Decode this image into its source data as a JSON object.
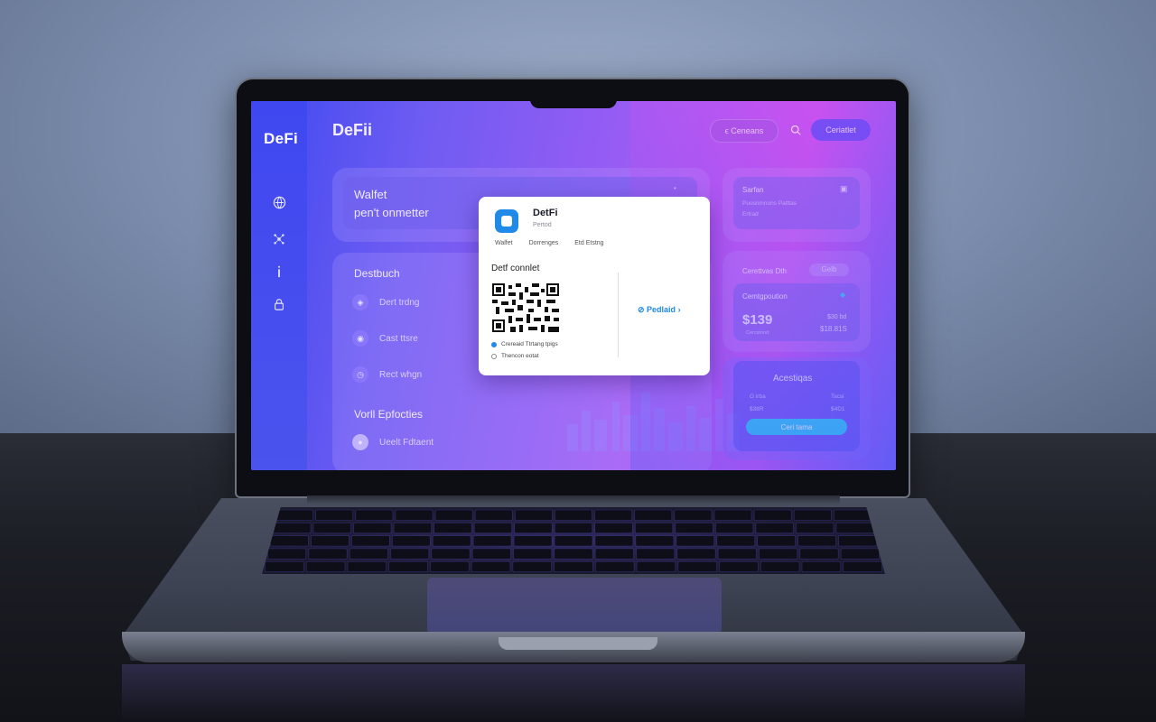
{
  "app": {
    "sidebar_logo": "DeFi",
    "brand": "DeFii",
    "header": {
      "status_pill": "ϵ Ceneans",
      "search_icon": "search-icon",
      "connect_label": "Ceriatlet"
    }
  },
  "sidebar": {
    "icons": [
      "globe-icon",
      "network-icon",
      "info-icon",
      "lock-icon"
    ]
  },
  "wallet_card": {
    "title": "Walfet",
    "subtitle": "pen't onmetter"
  },
  "dashboard": {
    "title": "Destbuch",
    "items": [
      {
        "icon": "shield-icon",
        "label": "Dert trdng"
      },
      {
        "icon": "user-icon",
        "label": "Cast ttsre"
      },
      {
        "icon": "clock-icon",
        "label": "Rect whgn"
      }
    ],
    "section2_title": "Vorll Epfocties",
    "section2_items": [
      {
        "icon": "pin-icon",
        "label": "Ueelt Fdtaent"
      }
    ]
  },
  "modal": {
    "title": "DetFi",
    "subtitle": "Pertod",
    "tabs": [
      "Walfet",
      "Dorrenges",
      "Etd Etstng"
    ],
    "heading": "Detf connlet",
    "cta": "Pedlaid",
    "options": [
      {
        "label": "Crereaid Ttrtang tpigs",
        "selected": true
      },
      {
        "label": "Thencon eotat",
        "selected": false
      }
    ]
  },
  "right_panel": {
    "top": {
      "title": "Sarfan",
      "line1": "Puosnmnons Patttas",
      "line2": "Ertrad"
    },
    "middle": {
      "title": "Cerettvas Dth",
      "chip": "Gelb",
      "subtitle": "Cemtgpoution",
      "amount": "$139",
      "amount_sub": "Cercstond",
      "right_top": "$30 bd",
      "right_bottom": "$18.81S"
    },
    "bottom": {
      "title": "Acestiqas",
      "row1_left": "G irba",
      "row1_right": "Tscsi",
      "row2_left": "$3ttR",
      "row2_right": "$4D1",
      "button": "Ceri tama"
    }
  },
  "colors": {
    "accent": "#5a4cf5",
    "cyan": "#2dc8f4",
    "modal_blue": "#1f8ae8"
  }
}
